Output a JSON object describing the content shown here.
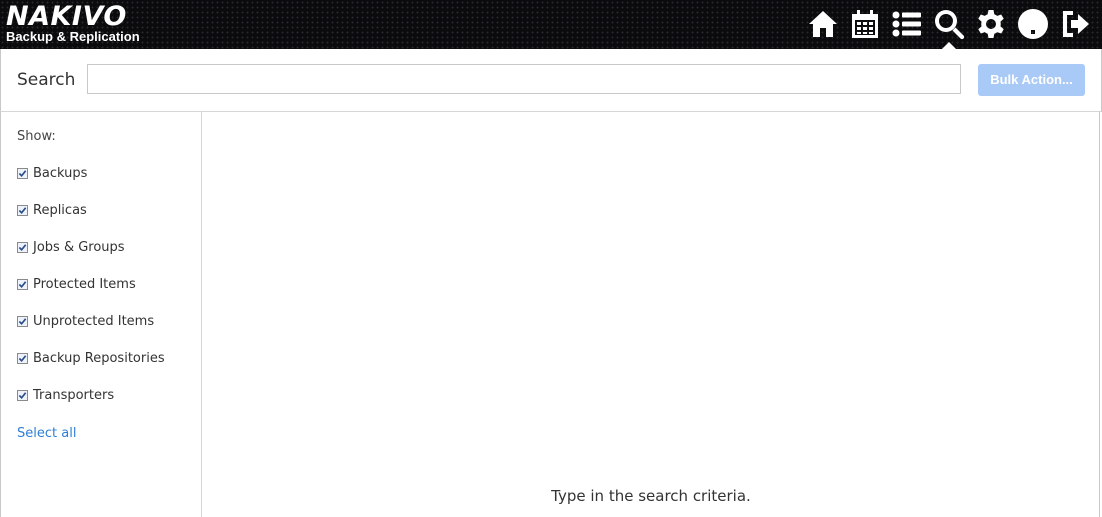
{
  "app": {
    "logo_title": "NAKIVO",
    "logo_subtitle": "Backup & Replication"
  },
  "nav": {
    "items": [
      {
        "name": "home-icon"
      },
      {
        "name": "calendar-icon"
      },
      {
        "name": "list-icon"
      },
      {
        "name": "search-icon",
        "active": true
      },
      {
        "name": "gear-icon"
      },
      {
        "name": "help-icon"
      },
      {
        "name": "logout-icon"
      }
    ]
  },
  "search": {
    "label": "Search",
    "value": "",
    "placeholder": "",
    "bulk_action_label": "Bulk Action..."
  },
  "sidebar": {
    "show_label": "Show:",
    "filters": [
      {
        "label": "Backups",
        "checked": true
      },
      {
        "label": "Replicas",
        "checked": true
      },
      {
        "label": "Jobs & Groups",
        "checked": true
      },
      {
        "label": "Protected Items",
        "checked": true
      },
      {
        "label": "Unprotected Items",
        "checked": true
      },
      {
        "label": "Backup Repositories",
        "checked": true
      },
      {
        "label": "Transporters",
        "checked": true
      }
    ],
    "select_all_label": "Select all"
  },
  "main": {
    "hint": "Type in the search criteria."
  },
  "colors": {
    "topbar_bg": "#0b0b0d",
    "bulk_button_bg": "#a9c9f6",
    "link": "#2f7fd6"
  }
}
